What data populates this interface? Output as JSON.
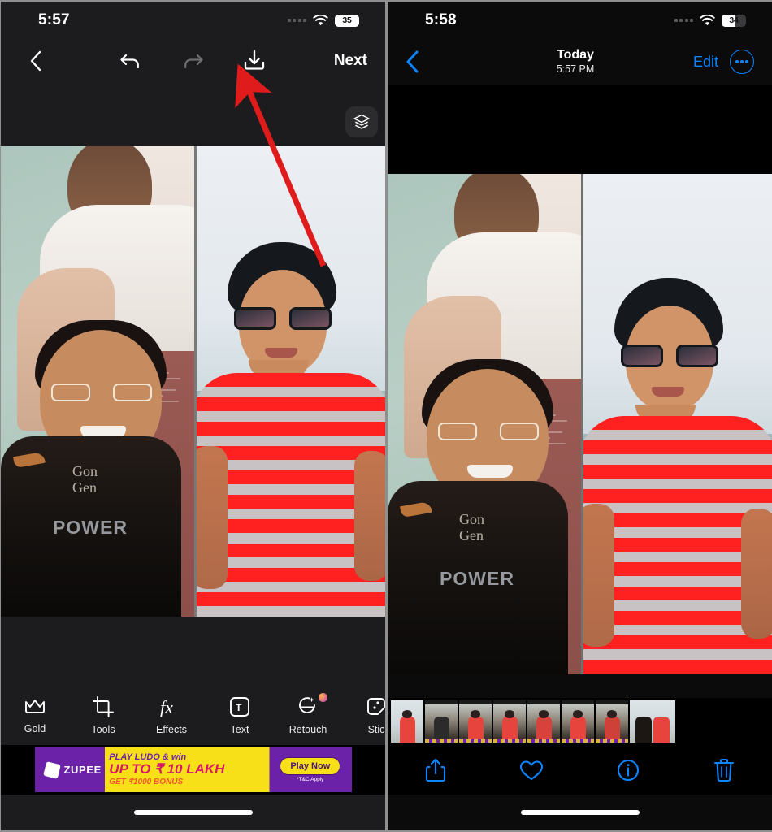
{
  "left_phone": {
    "app": "photo-editor",
    "status_bar": {
      "time": "5:57",
      "wifi_icon": "wifi-icon",
      "signal_icon": "cellular-dots-icon",
      "battery_percent": "35"
    },
    "editor_nav": {
      "back_icon": "chevron-left-icon",
      "undo_icon": "undo-arrow-icon",
      "redo_icon": "redo-arrow-icon",
      "save_icon": "download-save-icon",
      "next_label": "Next"
    },
    "canvas": {
      "layers_icon": "layers-icon"
    },
    "toolbar": [
      {
        "label": "Gold",
        "icon": "crown-icon",
        "badge": false
      },
      {
        "label": "Tools",
        "icon": "crop-icon",
        "badge": false
      },
      {
        "label": "Effects",
        "icon": "fx-icon",
        "badge": false
      },
      {
        "label": "Text",
        "icon": "text-box-icon",
        "badge": false
      },
      {
        "label": "Retouch",
        "icon": "retouch-face-icon",
        "badge": true
      },
      {
        "label": "Stic",
        "icon": "sticker-icon",
        "badge": false
      }
    ],
    "ad": {
      "brand": "ZUPEE",
      "line1": "PLAY LUDO & win",
      "line2": "UP TO ₹ 10 LAKH",
      "line3": "GET ₹1000 BONUS",
      "cta": "Play Now",
      "disclaimer": "*T&C Apply"
    }
  },
  "right_phone": {
    "app": "photos",
    "status_bar": {
      "time": "5:58",
      "wifi_icon": "wifi-icon",
      "signal_icon": "cellular-dots-icon",
      "battery_percent": "34"
    },
    "nav": {
      "back_icon": "chevron-left-icon",
      "title": "Today",
      "subtitle": "5:57 PM",
      "edit_label": "Edit",
      "more_icon": "more-ellipsis-icon"
    },
    "tabbar": [
      {
        "icon": "share-icon",
        "name": "share-button"
      },
      {
        "icon": "heart-icon",
        "name": "favorite-button"
      },
      {
        "icon": "info-icon",
        "name": "info-button"
      },
      {
        "icon": "trash-icon",
        "name": "delete-button"
      }
    ],
    "filmstrip_count": 8
  },
  "annotation": {
    "arrow_color": "#e01b1b",
    "points_to": "download-save-icon"
  },
  "colors": {
    "ios_blue": "#0a84ff",
    "panel_bg": "#1c1c1e",
    "black": "#000000",
    "arrow_red": "#e01b1b"
  }
}
